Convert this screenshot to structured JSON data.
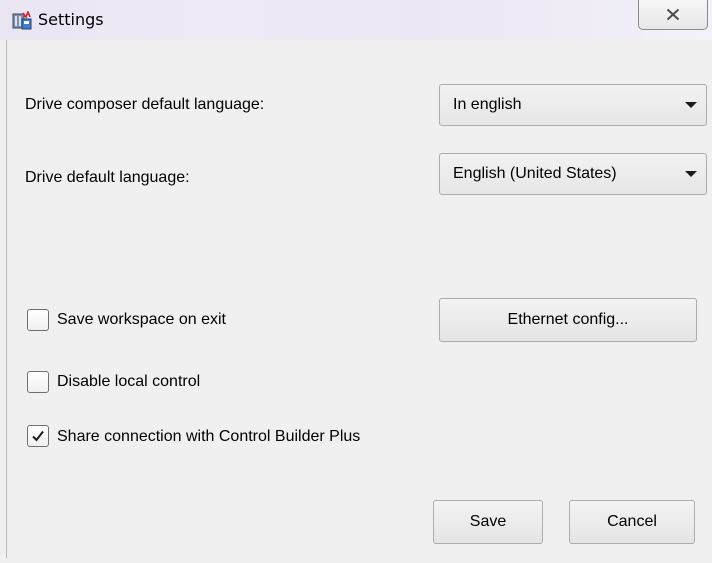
{
  "window": {
    "title": "Settings"
  },
  "form": {
    "composer_language": {
      "label": "Drive composer default language:",
      "value": "In english"
    },
    "drive_language": {
      "label": "Drive default language:",
      "value": "English (United States)"
    },
    "save_workspace": {
      "label": "Save workspace on exit",
      "checked": false
    },
    "disable_local_control": {
      "label": "Disable local control",
      "checked": false
    },
    "share_connection": {
      "label": "Share connection with Control Builder Plus",
      "checked": true
    },
    "ethernet_config_label": "Ethernet config..."
  },
  "footer": {
    "save_label": "Save",
    "cancel_label": "Cancel"
  },
  "icons": {
    "app": "settings-app-icon",
    "close": "close-icon",
    "dropdown": "chevron-down-icon",
    "check": "checkmark-icon"
  }
}
